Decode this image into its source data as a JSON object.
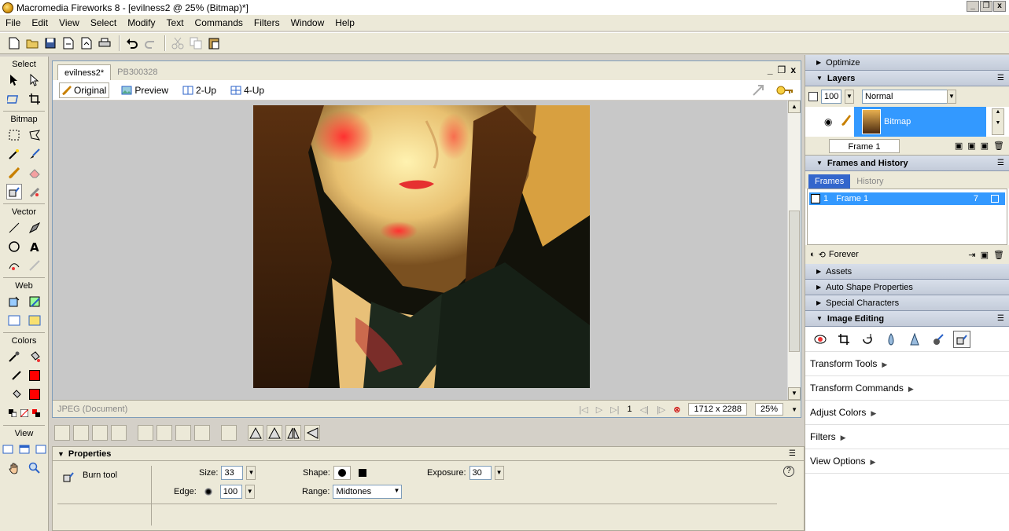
{
  "window": {
    "title": "Macromedia Fireworks 8 - [evilness2 @  25% (Bitmap)*]",
    "min_label": "_",
    "restore_label": "❐",
    "close_label": "x"
  },
  "menu": [
    "File",
    "Edit",
    "View",
    "Select",
    "Modify",
    "Text",
    "Commands",
    "Filters",
    "Window",
    "Help"
  ],
  "tools": {
    "groups": [
      "Select",
      "Bitmap",
      "Vector",
      "Web",
      "Colors",
      "View"
    ],
    "stroke_color": "#ff0000",
    "fill_color": "#ff0000"
  },
  "document": {
    "tabs": [
      "evilness2*",
      "PB300328"
    ],
    "views": [
      "Original",
      "Preview",
      "2-Up",
      "4-Up"
    ],
    "doc_type": "JPEG (Document)",
    "frame_number": "1",
    "dimensions": "1712 x 2288",
    "zoom": "25%"
  },
  "properties": {
    "title": "Properties",
    "tool_name": "Burn tool",
    "size_label": "Size:",
    "size_value": "33",
    "edge_label": "Edge:",
    "edge_value": "100",
    "shape_label": "Shape:",
    "range_label": "Range:",
    "range_value": "Midtones",
    "exposure_label": "Exposure:",
    "exposure_value": "30",
    "help_label": "?"
  },
  "panels": {
    "optimize": "Optimize",
    "layers": "Layers",
    "opacity": "100",
    "blend_mode": "Normal",
    "layer_name": "Bitmap",
    "frame_name": "Frame 1",
    "frames_history": "Frames and History",
    "frames_tab": "Frames",
    "history_tab": "History",
    "frame_row_index": "1",
    "frame_row_name": "Frame 1",
    "frame_row_delay": "7",
    "loop": "Forever",
    "assets": "Assets",
    "auto_shape": "Auto Shape Properties",
    "special_chars": "Special Characters",
    "image_editing": "Image Editing",
    "links": [
      "Transform Tools",
      "Transform Commands",
      "Adjust Colors",
      "Filters",
      "View Options"
    ]
  }
}
